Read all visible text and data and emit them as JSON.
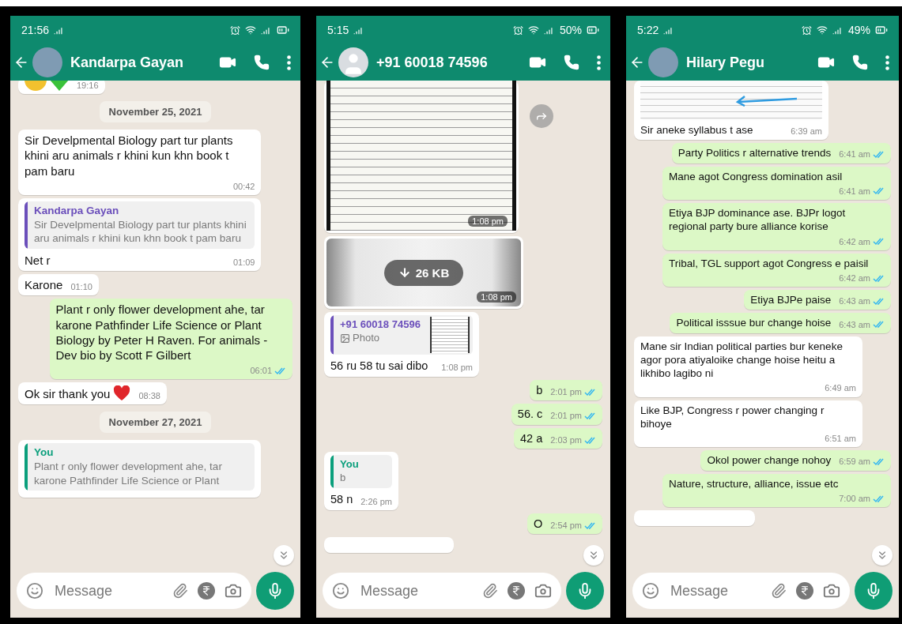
{
  "phones": [
    {
      "status": {
        "time": "21:56"
      },
      "contact": {
        "name": "Kandarpa Gayan",
        "has_photo": true
      },
      "messages": [
        {
          "kind": "sticker",
          "outgoing": false,
          "time": "19:16"
        },
        {
          "kind": "date",
          "text": "November 25, 2021"
        },
        {
          "kind": "text",
          "outgoing": false,
          "text": "Sir Develpmental Biology part tur plants khini aru animals r khini kun khn book t pam baru",
          "time": "00:42"
        },
        {
          "kind": "text",
          "outgoing": false,
          "quote": {
            "author": "Kandarpa Gayan",
            "color": "#6b4fbb",
            "text": "Sir Develpmental Biology part tur plants khini aru animals r khini kun khn book t pam baru"
          },
          "text": "Net r",
          "time": "01:09"
        },
        {
          "kind": "text",
          "outgoing": false,
          "text": "Karone",
          "time": "01:10"
        },
        {
          "kind": "text",
          "outgoing": true,
          "text": "Plant r only flower development ahe, tar karone Pathfinder Life Science or Plant Biology by Peter H Raven. For animals - Dev bio by Scott F Gilbert",
          "time": "06:01",
          "read": true
        },
        {
          "kind": "text",
          "outgoing": false,
          "text": "Ok sir thank you",
          "heart": true,
          "time": "08:38"
        },
        {
          "kind": "date",
          "text": "November 27, 2021"
        },
        {
          "kind": "text",
          "outgoing": false,
          "quote": {
            "author": "You",
            "color": "#0a9f7c",
            "text": "Plant r only flower development ahe, tar karone Pathfinder Life Science or Plant"
          }
        }
      ],
      "composer": {
        "placeholder": "Message"
      }
    },
    {
      "status": {
        "time": "5:15",
        "battery": "50%"
      },
      "contact": {
        "name": "+91 60018 74596",
        "has_photo": false
      },
      "messages": [
        {
          "kind": "photo",
          "outgoing": false,
          "time": "1:08 pm",
          "forward": true
        },
        {
          "kind": "download",
          "outgoing": false,
          "size": "26 KB",
          "time": "1:08 pm"
        },
        {
          "kind": "text",
          "outgoing": false,
          "quote": {
            "author": "+91 60018 74596",
            "color": "#6b4fbb",
            "text": "Photo",
            "has_thumbnail": true
          },
          "text": "56 ru 58 tu sai dibo",
          "time": "1:08 pm"
        },
        {
          "kind": "text",
          "outgoing": true,
          "text": "b",
          "time": "2:01 pm",
          "read": true
        },
        {
          "kind": "text",
          "outgoing": true,
          "text": "56. c",
          "time": "2:01 pm",
          "read": true
        },
        {
          "kind": "text",
          "outgoing": true,
          "text": "42 a",
          "time": "2:03 pm",
          "read": true
        },
        {
          "kind": "text",
          "outgoing": false,
          "quote": {
            "author": "You",
            "color": "#0a9f7c",
            "text": "b"
          },
          "text": "58 n",
          "time": "2:26 pm"
        },
        {
          "kind": "text",
          "outgoing": true,
          "text": "O",
          "time": "2:54 pm",
          "read": true
        },
        {
          "kind": "cut",
          "outgoing": false
        }
      ],
      "composer": {
        "placeholder": "Message"
      }
    },
    {
      "status": {
        "time": "5:22",
        "battery": "49%"
      },
      "contact": {
        "name": "Hilary Pegu",
        "has_photo": true
      },
      "messages": [
        {
          "kind": "photo",
          "outgoing": false,
          "caption": "Sir aneke syllabus t ase",
          "time": "6:39 am"
        },
        {
          "kind": "text",
          "outgoing": true,
          "text": "Party Politics r alternative trends",
          "time": "6:41 am",
          "read": true
        },
        {
          "kind": "text",
          "outgoing": true,
          "text": "Mane agot Congress domination asil",
          "time": "6:41 am",
          "read": true
        },
        {
          "kind": "text",
          "outgoing": true,
          "text": "Etiya BJP dominance ase. BJPr logot regional party bure alliance korise",
          "time": "6:42 am",
          "read": true
        },
        {
          "kind": "text",
          "outgoing": true,
          "text": "Tribal, TGL support agot Congress e paisil",
          "time": "6:42 am",
          "read": true
        },
        {
          "kind": "text",
          "outgoing": true,
          "text": "Etiya BJPe paise",
          "time": "6:43 am",
          "read": true
        },
        {
          "kind": "text",
          "outgoing": true,
          "text": "Political isssue bur change hoise",
          "time": "6:43 am",
          "read": true
        },
        {
          "kind": "text",
          "outgoing": false,
          "text": "Mane sir Indian political parties bur keneke agor pora atiyaloike change hoise heitu a likhibo lagibo ni",
          "time": "6:49 am"
        },
        {
          "kind": "text",
          "outgoing": false,
          "text": "Like BJP, Congress r power changing r bihoye",
          "time": "6:51 am"
        },
        {
          "kind": "text",
          "outgoing": true,
          "text": "Okol power change nohoy",
          "time": "6:59 am",
          "read": true
        },
        {
          "kind": "text",
          "outgoing": true,
          "text": "Nature, structure, alliance, issue etc",
          "time": "7:00 am",
          "read": true
        },
        {
          "kind": "cut",
          "outgoing": false
        }
      ],
      "composer": {
        "placeholder": "Message"
      }
    }
  ]
}
